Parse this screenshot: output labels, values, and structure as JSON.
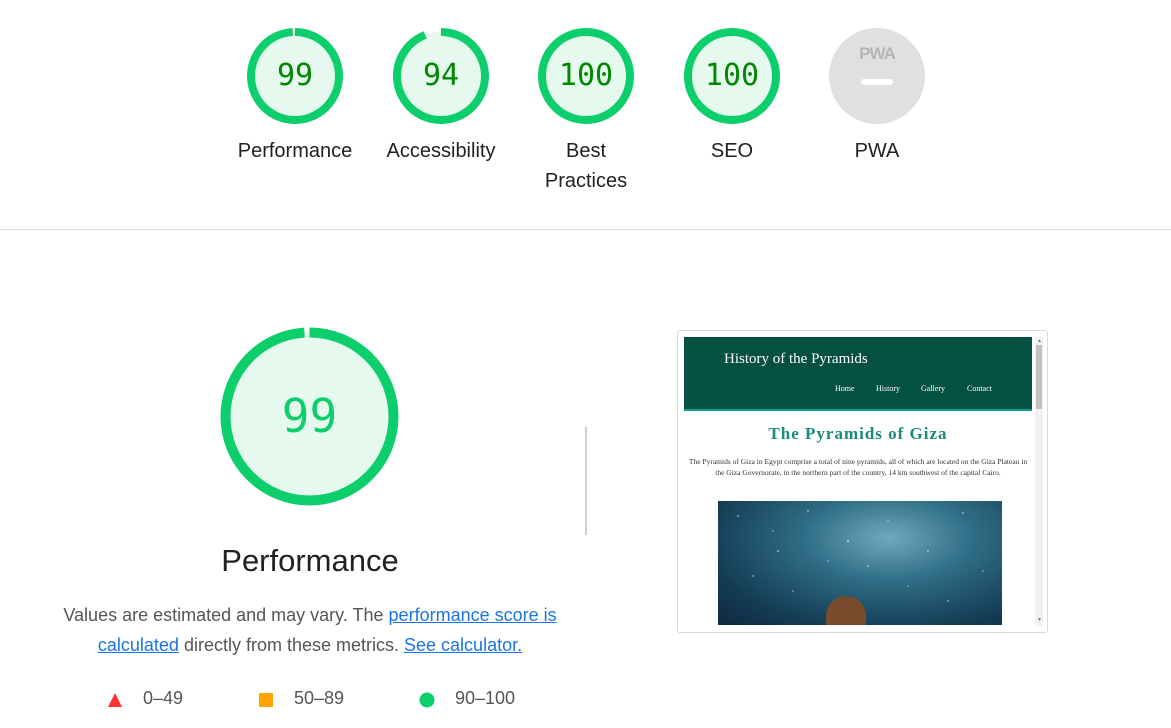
{
  "gauges": [
    {
      "label": "Performance",
      "score": "99"
    },
    {
      "label": "Accessibility",
      "score": "94"
    },
    {
      "label": "Best Practices",
      "score": "100"
    },
    {
      "label": "SEO",
      "score": "100"
    },
    {
      "label": "PWA",
      "score": ""
    }
  ],
  "gauge_scores_fraction": [
    0.99,
    0.94,
    1.0,
    1.0
  ],
  "pwa_badge_text": "PWA",
  "performance": {
    "score": "99",
    "title": "Performance",
    "desc_prefix": "Values are estimated and may vary. The ",
    "desc_link1": "performance score is calculated",
    "desc_middle": " directly from these metrics. ",
    "desc_link2": "See calculator."
  },
  "legend": [
    {
      "range": "0–49",
      "shape": "triangle",
      "color": "#ff3333"
    },
    {
      "range": "50–89",
      "shape": "square",
      "color": "#ffa400"
    },
    {
      "range": "90–100",
      "shape": "circle",
      "color": "#0cce6b"
    }
  ],
  "colors": {
    "pass": "#0cce6b",
    "pass_text": "#008800",
    "pass_bg": "#e5f9ee",
    "link": "#1a73e8"
  },
  "screenshot": {
    "site_title": "History of the Pyramids",
    "nav": [
      "Home",
      "History",
      "Gallery",
      "Contact"
    ],
    "heading": "The Pyramids of Giza",
    "paragraph": "The Pyramids of Giza in Egypt comprise a total of nine pyramids, all of which are located on the Giza Plateau in the Giza Governorate, in the northern part of the country, 14 km southwest of the capital Cairo."
  }
}
